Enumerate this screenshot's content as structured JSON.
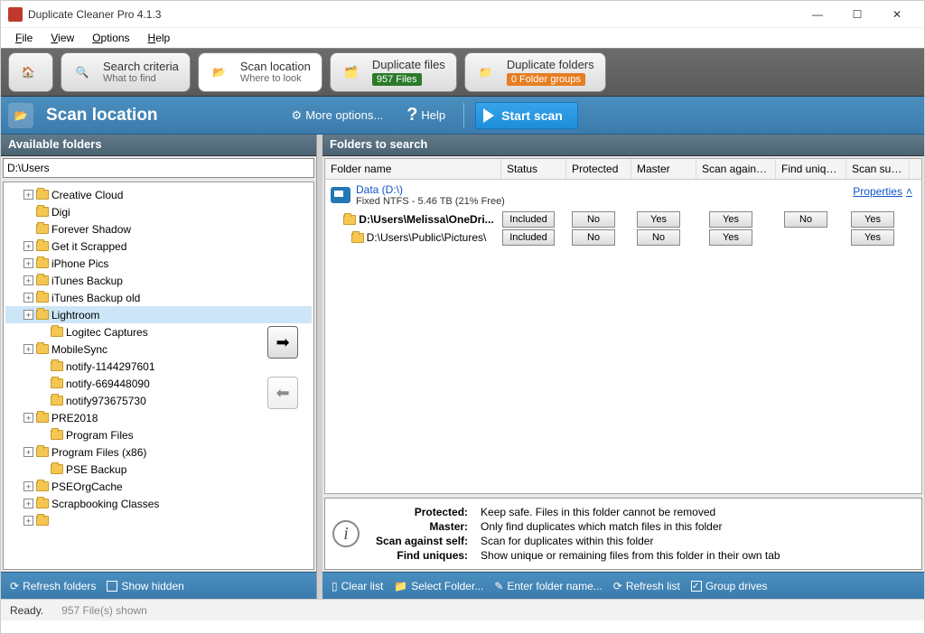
{
  "window": {
    "title": "Duplicate Cleaner Pro 4.1.3"
  },
  "menu": [
    "File",
    "View",
    "Options",
    "Help"
  ],
  "tabs": {
    "home": "",
    "criteria": {
      "title": "Search criteria",
      "sub": "What to find"
    },
    "location": {
      "title": "Scan location",
      "sub": "Where to look"
    },
    "files": {
      "title": "Duplicate files",
      "badge": "957 Files"
    },
    "folders": {
      "title": "Duplicate folders",
      "badge": "0 Folder groups"
    }
  },
  "header": {
    "title": "Scan location",
    "more": "More options...",
    "help": "Help",
    "start": "Start scan"
  },
  "left": {
    "title": "Available folders",
    "path": "D:\\Users",
    "items": [
      {
        "exp": true,
        "label": "Creative Cloud"
      },
      {
        "exp": false,
        "label": "Digi"
      },
      {
        "exp": false,
        "label": "Forever Shadow"
      },
      {
        "exp": true,
        "label": "Get it Scrapped"
      },
      {
        "exp": true,
        "label": "iPhone Pics"
      },
      {
        "exp": true,
        "label": "iTunes Backup"
      },
      {
        "exp": true,
        "label": "iTunes Backup old"
      },
      {
        "exp": true,
        "label": "Lightroom",
        "sel": true
      },
      {
        "exp": false,
        "indent": true,
        "label": "Logitec Captures"
      },
      {
        "exp": true,
        "label": "MobileSync"
      },
      {
        "exp": false,
        "indent": true,
        "label": "notify-1144297601"
      },
      {
        "exp": false,
        "indent": true,
        "label": "notify-669448090"
      },
      {
        "exp": false,
        "indent": true,
        "label": "notify973675730"
      },
      {
        "exp": true,
        "label": "PRE2018"
      },
      {
        "exp": false,
        "indent": true,
        "label": "Program Files"
      },
      {
        "exp": true,
        "label": "Program Files (x86)"
      },
      {
        "exp": false,
        "indent": true,
        "label": "PSE Backup"
      },
      {
        "exp": true,
        "label": "PSEOrgCache"
      },
      {
        "exp": true,
        "label": "Scrapbooking Classes"
      },
      {
        "exp": true,
        "label": ""
      }
    ],
    "footer": {
      "refresh": "Refresh folders",
      "showhidden": "Show hidden"
    }
  },
  "right": {
    "title": "Folders to search",
    "columns": [
      "Folder name",
      "Status",
      "Protected",
      "Master",
      "Scan against s...",
      "Find uniques",
      "Scan subfo..."
    ],
    "drive": {
      "title": "Data (D:\\)",
      "sub": "Fixed NTFS - 5.46 TB (21% Free)",
      "props": "Properties"
    },
    "rows": [
      {
        "path": "D:\\Users\\Melissa\\OneDri...",
        "bold": true,
        "status": "Included",
        "prot": "No",
        "master": "Yes",
        "sas": "Yes",
        "uniq": "No",
        "sub": "Yes"
      },
      {
        "path": "D:\\Users\\Public\\Pictures\\",
        "bold": false,
        "status": "Included",
        "prot": "No",
        "master": "No",
        "sas": "Yes",
        "uniq": "",
        "sub": "Yes"
      }
    ],
    "legend": {
      "Protected:": "Keep safe. Files in this folder cannot be removed",
      "Master:": "Only find duplicates which match files in this folder",
      "Scan against self:": "Scan for duplicates within this folder",
      "Find uniques:": "Show unique or remaining files from this folder in their own tab"
    },
    "footer": {
      "clear": "Clear list",
      "select": "Select Folder...",
      "enter": "Enter folder name...",
      "refresh": "Refresh list",
      "group": "Group drives"
    }
  },
  "status": {
    "ready": "Ready.",
    "files": "957 File(s) shown"
  }
}
